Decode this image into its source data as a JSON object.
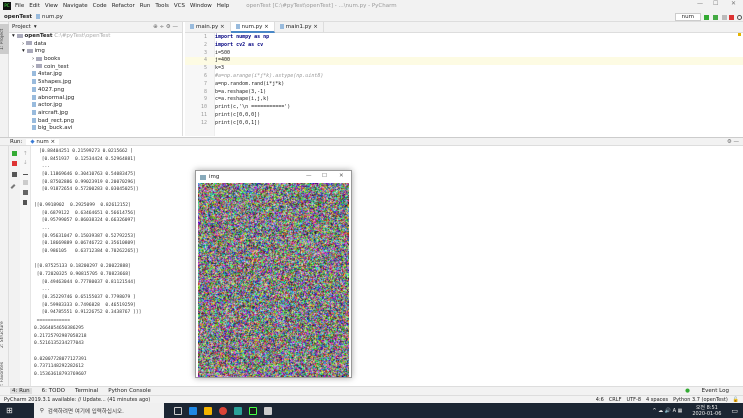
{
  "menu": {
    "items": [
      "File",
      "Edit",
      "View",
      "Navigate",
      "Code",
      "Refactor",
      "Run",
      "Tools",
      "VCS",
      "Window",
      "Help"
    ],
    "window_title": "openTest [C:\\#pyTest\\openTest] - ...\\num.py - PyCharm"
  },
  "nav": {
    "project": "openTest",
    "file": "num.py",
    "run_config": "num"
  },
  "project": {
    "header": "Project",
    "root": "openTest",
    "root_path": "C:\\#pyTest\\openTest",
    "items": [
      {
        "name": "data",
        "type": "folder",
        "depth": 1
      },
      {
        "name": "img",
        "type": "folder",
        "depth": 1
      },
      {
        "name": "books",
        "type": "folder",
        "depth": 2
      },
      {
        "name": "coin_test",
        "type": "folder",
        "depth": 2
      },
      {
        "name": "4star.jpg",
        "type": "file",
        "depth": 2
      },
      {
        "name": "5shapes.jpg",
        "type": "file",
        "depth": 2
      },
      {
        "name": "4027.png",
        "type": "file",
        "depth": 2
      },
      {
        "name": "abnormal.jpg",
        "type": "file",
        "depth": 2
      },
      {
        "name": "actor.jpg",
        "type": "file",
        "depth": 2
      },
      {
        "name": "aircraft.jpg",
        "type": "file",
        "depth": 2
      },
      {
        "name": "bad_rect.png",
        "type": "file",
        "depth": 2
      },
      {
        "name": "big_buck.avi",
        "type": "file",
        "depth": 2
      }
    ]
  },
  "sidebar_tabs": {
    "project": "1: Project",
    "structure": "2: Structure",
    "favorites": "2: Favorites"
  },
  "tabs": [
    "main.py",
    "num.py",
    "main1.py"
  ],
  "code": [
    "import numpy as np",
    "import cv2 as cv",
    "i=500",
    "j=400",
    "k=3",
    "#a=np.arange(i*j*k).astype(np.uint8)",
    "a=np.random.rand(i*j*k)",
    "b=a.reshape(3,-1)",
    "c=a.reshape(i,j,k)",
    "print(c,'\\n  ===========')",
    "print(c[0,0,0])",
    "print(c[0,0,1])"
  ],
  "run": {
    "label": "Run:",
    "tab": "num"
  },
  "console": [
    "[0.88404251 0.21599273 0.0215662 ]",
    " [0.8451937  0.12534424 0.52964881]",
    " ...",
    " [0.11869646 0.30410763 0.54083475]",
    " [0.87502886 0.99023919 0.20070296]",
    " [0.91872654 0.57200283 0.03045025]]",
    "",
    "[[0.9918902  0.2925099  0.82612152]",
    " [0.6879122  0.63464651 0.56614756]",
    " [0.95799057 0.86038324 0.66326097]",
    " ...",
    " [0.95631047 0.15039387 0.52792253]",
    " [0.18669889 0.06746722 0.35610809]",
    " [0.986105   0.63712384 0.70262265]]",
    "",
    "[[0.87525133 0.18200297 0.20022888]",
    " [0.72020325 0.90815705 0.70823668]",
    " [0.49463044 0.77780037 0.81121544]",
    " ...",
    " [0.35229746 0.65155037 0.7798079 ]",
    " [0.59983333 0.7496828  0.46519259]",
    " [0.94785551 0.91226752 0.3438767 ]]]",
    " ============",
    "0.2664054650386295",
    "0.21725792987058218",
    "0.5216135234277043",
    "",
    "0.02007728077127391",
    "0.7371148292282612",
    "0.15363618793769607"
  ],
  "img_window": {
    "title": "img"
  },
  "bottom_tabs": [
    "4: Run",
    "6: TODO",
    "Terminal",
    "Python Console"
  ],
  "event_log": "Event Log",
  "status": {
    "message": "PyCharm 2019.3.1 available: // Update... (41 minutes ago)",
    "position": "4:6",
    "line_sep": "CRLF",
    "encoding": "UTF-8",
    "indent": "4 spaces",
    "interpreter": "Python 3.7 (openTest)"
  },
  "taskbar": {
    "search_placeholder": "검색하려면 여기에 입력하십시오.",
    "time": "오전 8:51",
    "date": "2020-01-06",
    "lang": "A"
  }
}
